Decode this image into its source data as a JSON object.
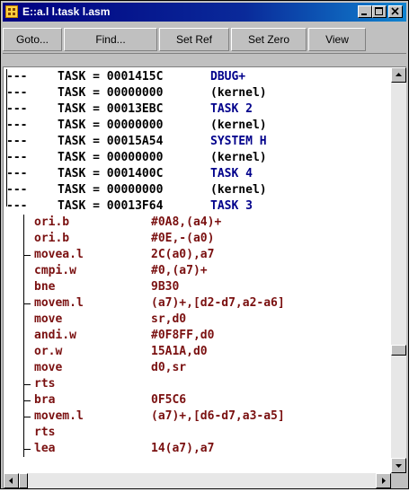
{
  "window": {
    "title": "E::a.l l.task l.asm"
  },
  "toolbar": {
    "buttons": [
      "Goto...",
      "Find...",
      "Set Ref",
      "Set Zero",
      "View"
    ]
  },
  "tasks": [
    {
      "prefix": "---",
      "label": "TASK = 0001415C",
      "name": "DBUG+",
      "kernel": false
    },
    {
      "prefix": "---",
      "label": "TASK = 00000000",
      "name": "(kernel)",
      "kernel": true
    },
    {
      "prefix": "---",
      "label": "TASK = 00013EBC",
      "name": "TASK 2",
      "kernel": false
    },
    {
      "prefix": "---",
      "label": "TASK = 00000000",
      "name": "(kernel)",
      "kernel": true
    },
    {
      "prefix": "---",
      "label": "TASK = 00015A54",
      "name": "SYSTEM H",
      "kernel": false
    },
    {
      "prefix": "---",
      "label": "TASK = 00000000",
      "name": "(kernel)",
      "kernel": true
    },
    {
      "prefix": "---",
      "label": "TASK = 0001400C",
      "name": "TASK 4",
      "kernel": false
    },
    {
      "prefix": "---",
      "label": "TASK = 00000000",
      "name": "(kernel)",
      "kernel": true
    },
    {
      "prefix": "---",
      "label": "TASK = 00013F64",
      "name": "TASK 3",
      "kernel": false
    }
  ],
  "code": [
    {
      "mnemonic": "ori.b",
      "operands": "#0A8,(a4)+",
      "branch": false
    },
    {
      "mnemonic": "ori.b",
      "operands": "#0E,-(a0)",
      "branch": false
    },
    {
      "mnemonic": "movea.l",
      "operands": "2C(a0),a7",
      "branch": true
    },
    {
      "mnemonic": "cmpi.w",
      "operands": "#0,(a7)+",
      "branch": false
    },
    {
      "mnemonic": "bne",
      "operands": "9B30",
      "branch": false
    },
    {
      "mnemonic": "movem.l",
      "operands": "(a7)+,[d2-d7,a2-a6]",
      "branch": true
    },
    {
      "mnemonic": "move",
      "operands": "sr,d0",
      "branch": false
    },
    {
      "mnemonic": "andi.w",
      "operands": "#0F8FF,d0",
      "branch": false
    },
    {
      "mnemonic": "or.w",
      "operands": "15A1A,d0",
      "branch": false
    },
    {
      "mnemonic": "move",
      "operands": "d0,sr",
      "branch": false
    },
    {
      "mnemonic": "rts",
      "operands": "",
      "branch": true
    },
    {
      "mnemonic": "bra",
      "operands": "0F5C6",
      "branch": true
    },
    {
      "mnemonic": "movem.l",
      "operands": "(a7)+,[d6-d7,a3-a5]",
      "branch": true
    },
    {
      "mnemonic": "rts",
      "operands": "",
      "branch": false
    },
    {
      "mnemonic": "lea",
      "operands": "14(a7),a7",
      "branch": true
    }
  ],
  "icons": {
    "app": "module-icon",
    "minimize": "minimize-icon",
    "maximize": "maximize-icon",
    "close": "close-icon"
  },
  "colors": {
    "titlebar": "#000080",
    "task_name": "#00008b",
    "code": "#7a1010"
  }
}
